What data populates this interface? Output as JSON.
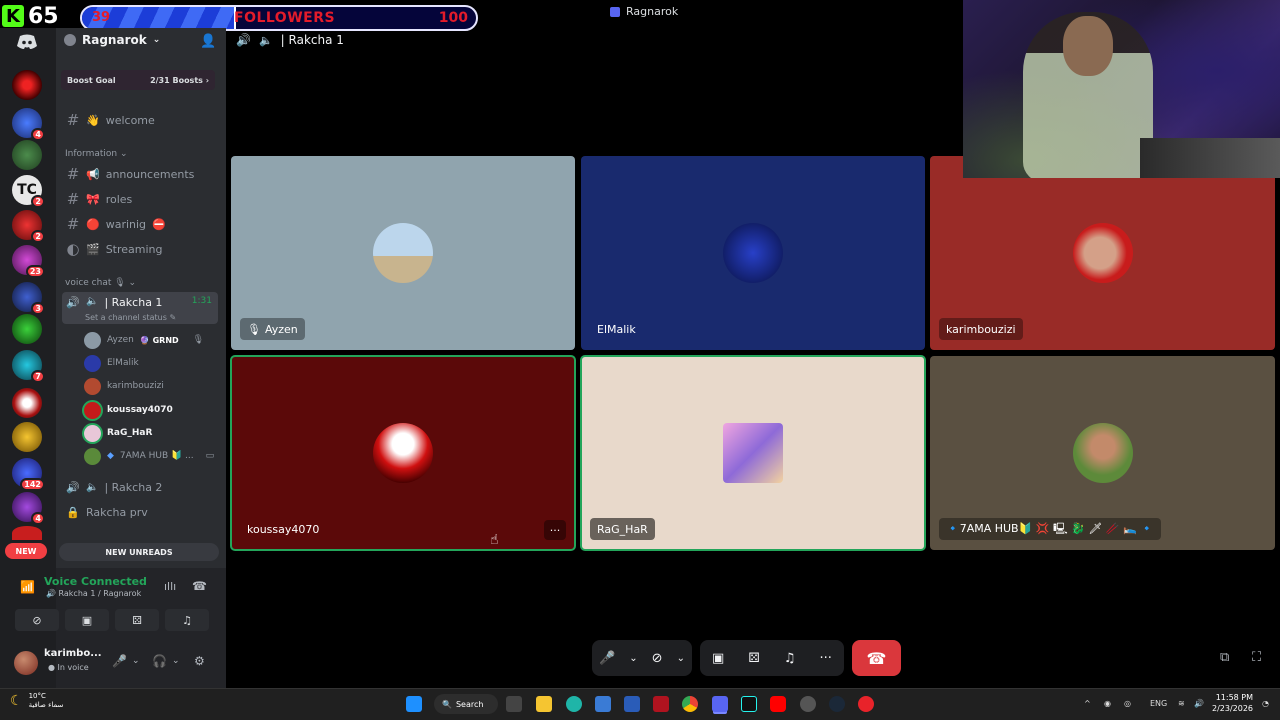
{
  "overlay": {
    "kick_logo": "K",
    "kick_count": "65",
    "followers_current": "39",
    "followers_label": "FOLLOWERS",
    "followers_target": "100",
    "followers_progress": 0.39
  },
  "window": {
    "title": "Ragnarok"
  },
  "server_rail": {
    "badges": [
      "4",
      "2",
      "2",
      "23",
      "3",
      "7",
      "142",
      "4"
    ],
    "new_pill": "NEW"
  },
  "sidebar": {
    "server_name": "Ragnarok",
    "boost": {
      "label": "Boost Goal",
      "progress": "2/31 Boosts"
    },
    "channels_top": [
      {
        "name": "welcome",
        "emoji": "👋"
      }
    ],
    "category_information": "Information",
    "channels_info": [
      {
        "name": "announcements",
        "emoji": "📢"
      },
      {
        "name": "roles",
        "emoji": "🎀"
      },
      {
        "name": "warinig",
        "emoji": "🔴",
        "suffix": "⛔"
      },
      {
        "name": "Streaming",
        "emoji": "🎬"
      }
    ],
    "category_voice": "voice chat",
    "voice_channel": {
      "name": "Rakcha 1",
      "time": "1:31",
      "status": "Set a channel status"
    },
    "voice_users": [
      {
        "name": "Ayzen",
        "tag": "GRND"
      },
      {
        "name": "ElMalik"
      },
      {
        "name": "karimbouzizi"
      },
      {
        "name": "koussay4070"
      },
      {
        "name": "RaG_HaR"
      },
      {
        "name": "7AMA HUB 🔰 ..."
      }
    ],
    "voice_channel_2": "Rakcha 2",
    "voice_channel_prv": "Rakcha prv",
    "new_unreads": "NEW UNREADS"
  },
  "voice_panel": {
    "title": "Voice Connected",
    "subtitle": "Rakcha 1 / Ragnarok",
    "user_name": "karimbo...",
    "user_status": "In voice"
  },
  "main": {
    "channel_title": "Rakcha 1",
    "tiles": [
      {
        "name": "Ayzen",
        "muted": true
      },
      {
        "name": "ElMalik"
      },
      {
        "name": "karimbouzizi"
      },
      {
        "name": "koussay4070"
      },
      {
        "name": "RaG_HaR"
      },
      {
        "name": "🔹7AMA HUB🔰 💢 🖳 🐉 🗡 🥢 🛌 🔹"
      }
    ],
    "more_label": "···"
  },
  "taskbar": {
    "weather_temp": "10°C",
    "weather_desc": "سماء صافية",
    "search_label": "Search",
    "lang": "ENG",
    "time": "11:58 PM",
    "date": "2/23/2026"
  },
  "colors": {
    "discord_green": "#23a55a",
    "hangup_red": "#da373c",
    "followers_text": "#e31b2a",
    "kick_green": "#53fc18"
  }
}
